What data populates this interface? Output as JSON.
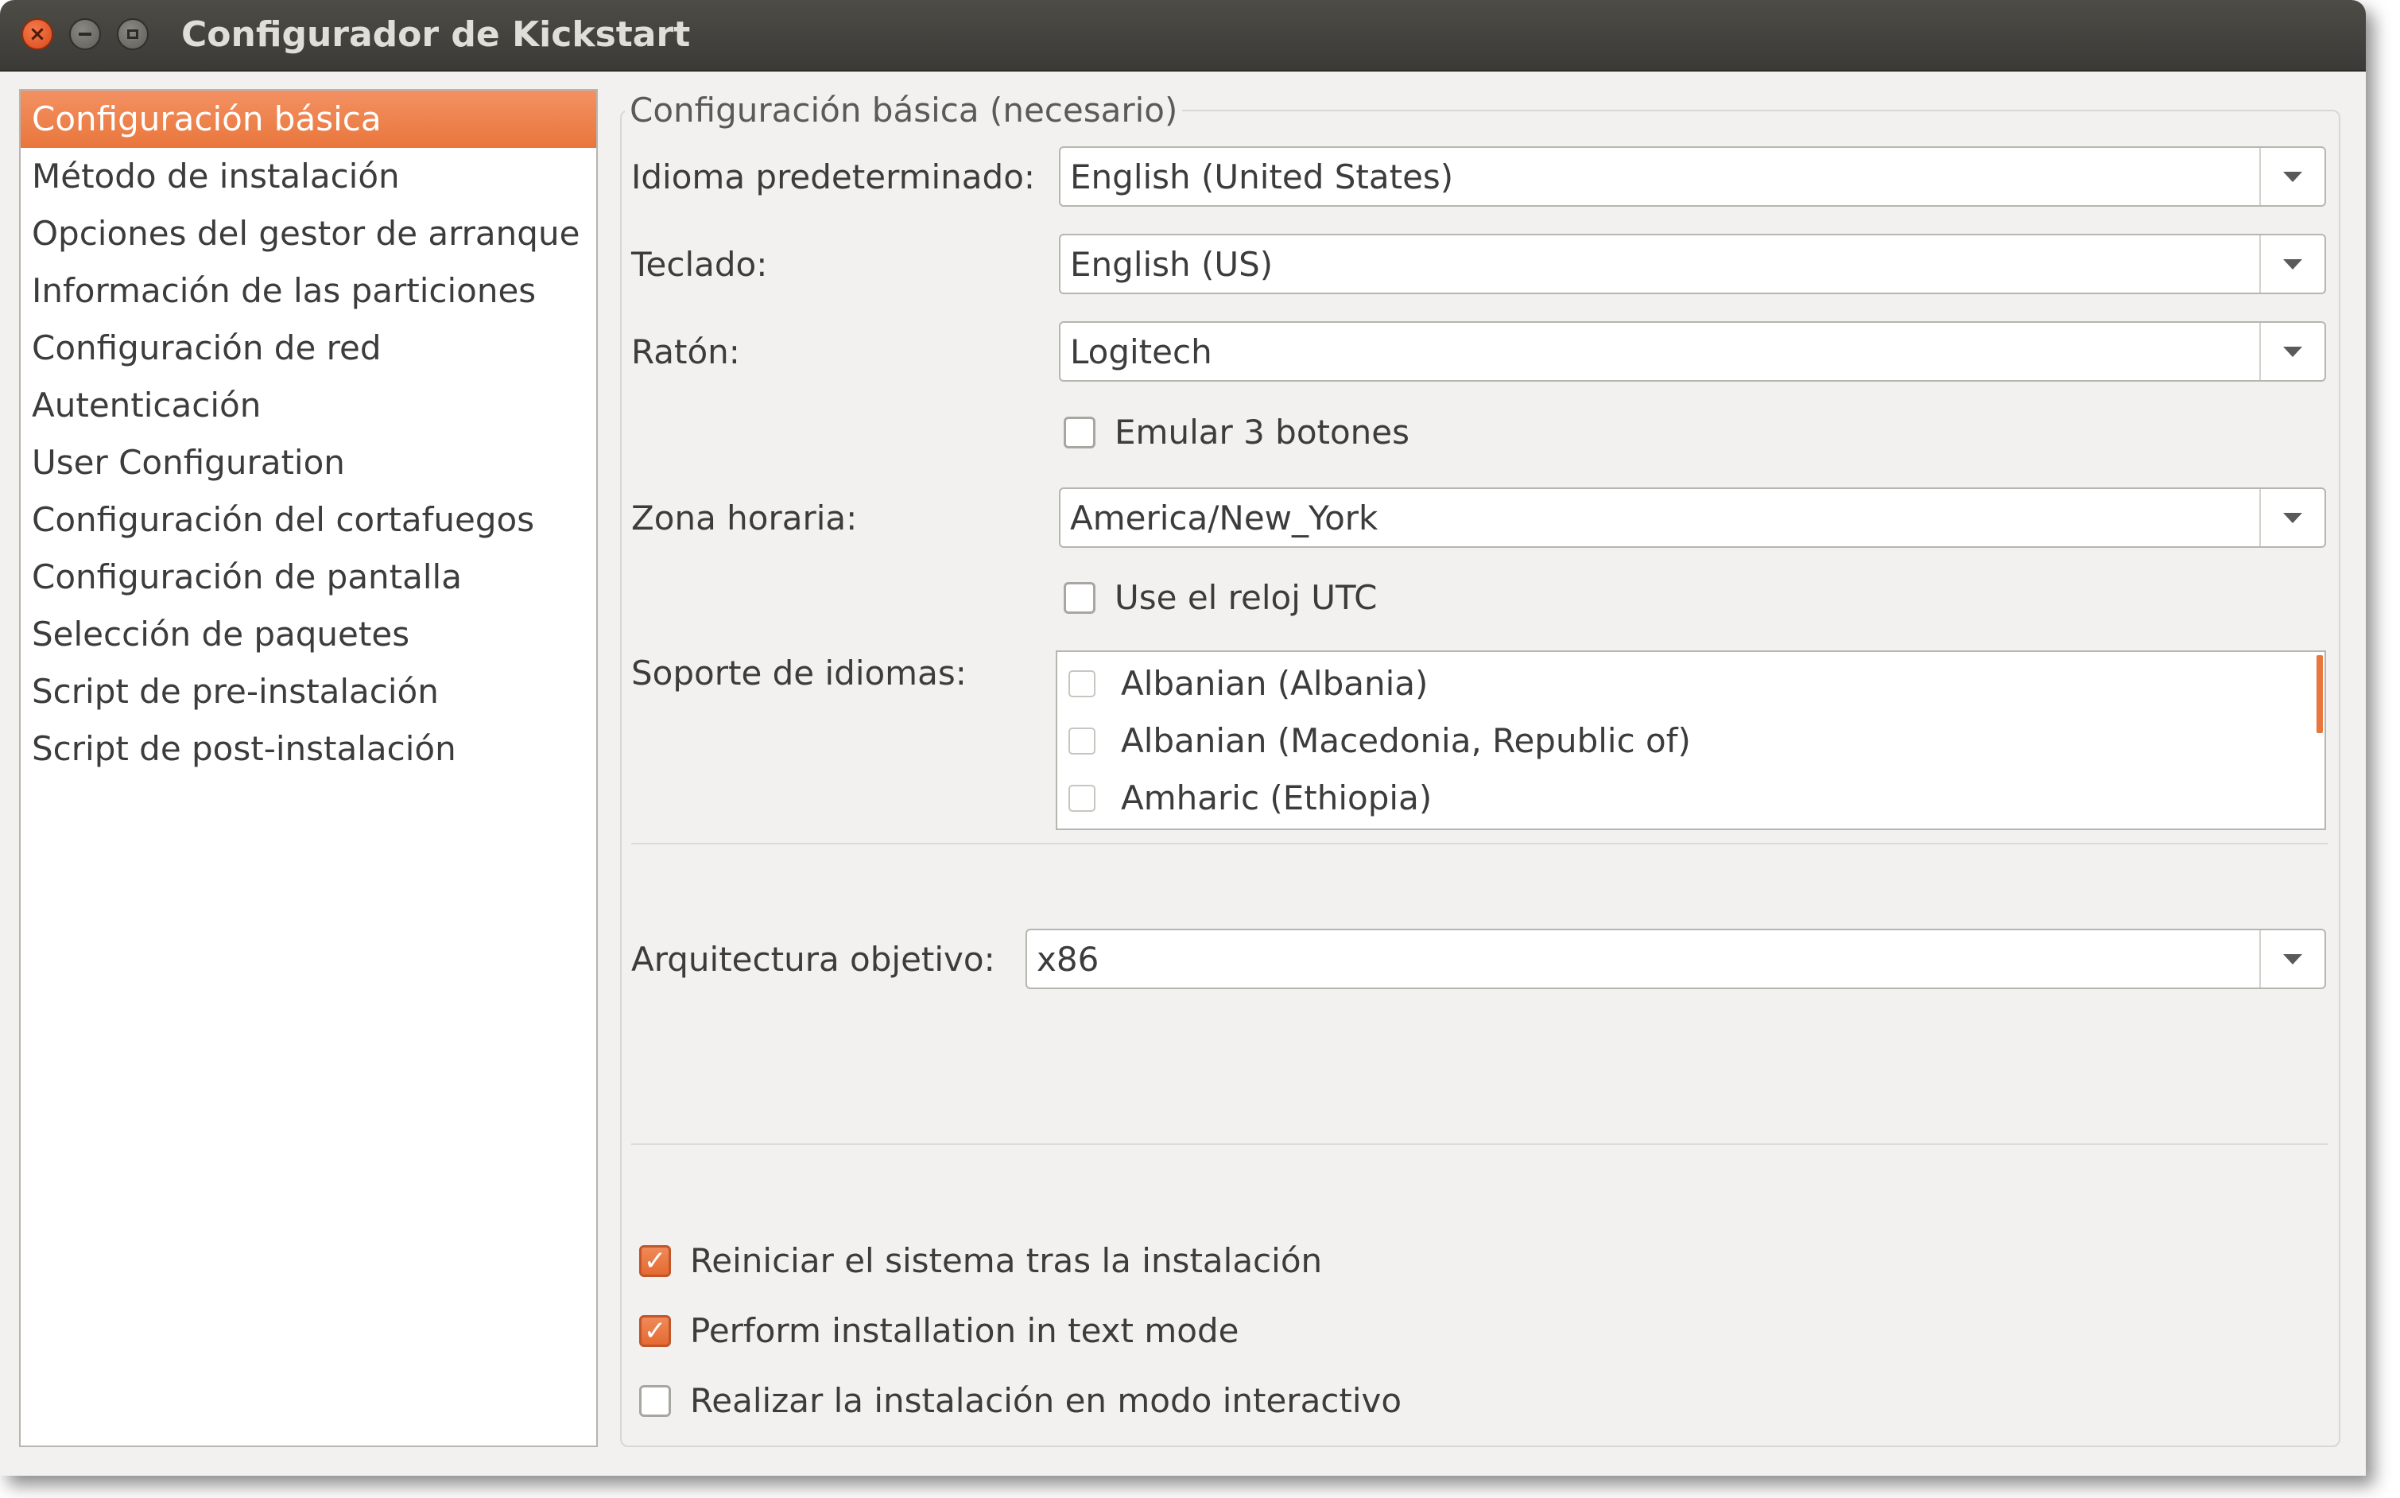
{
  "window": {
    "title": "Configurador de Kickstart",
    "close_glyph": "×"
  },
  "sidebar": {
    "items": [
      {
        "label": "Configuración básica",
        "selected": true
      },
      {
        "label": "Método de instalación"
      },
      {
        "label": "Opciones del gestor de arranque"
      },
      {
        "label": "Información de las particiones"
      },
      {
        "label": "Configuración de red"
      },
      {
        "label": "Autenticación"
      },
      {
        "label": "User Configuration"
      },
      {
        "label": "Configuración del cortafuegos"
      },
      {
        "label": "Configuración de pantalla"
      },
      {
        "label": "Selección de paquetes"
      },
      {
        "label": "Script de pre-instalación"
      },
      {
        "label": "Script de post-instalación"
      }
    ]
  },
  "main": {
    "frame_title": "Configuración básica (necesario)",
    "default_language": {
      "label": "Idioma predeterminado:",
      "value": "English (United States)"
    },
    "keyboard": {
      "label": "Teclado:",
      "value": "English (US)"
    },
    "mouse": {
      "label": "Ratón:",
      "value": "Logitech"
    },
    "emulate_3_buttons": {
      "label": "Emular 3 botones",
      "checked": false
    },
    "timezone": {
      "label": "Zona horaria:",
      "value": "America/New_York"
    },
    "utc_clock": {
      "label": "Use el reloj UTC",
      "checked": false
    },
    "language_support": {
      "label": "Soporte de idiomas:",
      "items": [
        {
          "label": "Albanian (Albania)",
          "checked": false
        },
        {
          "label": "Albanian (Macedonia, Republic of)",
          "checked": false
        },
        {
          "label": "Amharic (Ethiopia)",
          "checked": false
        }
      ]
    },
    "target_arch": {
      "label": "Arquitectura objetivo:",
      "value": "x86"
    },
    "options": {
      "reboot": {
        "label": "Reiniciar el sistema tras la instalación",
        "checked": true
      },
      "text_mode": {
        "label": "Perform installation in text mode",
        "checked": true
      },
      "interactive": {
        "label": "Realizar la instalación en modo interactivo",
        "checked": false
      },
      "check_glyph": "✓"
    }
  },
  "colors": {
    "accent": "#e9763c",
    "titlebar": "#3c3b37",
    "window_bg": "#f2f1f0"
  },
  "icons": {
    "close": "close-icon",
    "minimize": "minimize-icon",
    "maximize": "maximize-icon",
    "dropdown": "chevron-down-icon",
    "check": "check-icon"
  }
}
